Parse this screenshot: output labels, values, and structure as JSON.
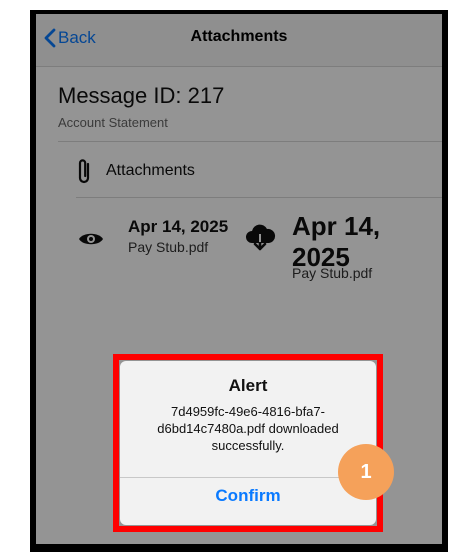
{
  "nav": {
    "back_label": "Back",
    "title": "Attachments"
  },
  "message": {
    "id_label": "Message ID: 217",
    "subtitle": "Account Statement"
  },
  "attachments_header": {
    "icon": "paperclip-icon",
    "label": "Attachments"
  },
  "items": [
    {
      "date": "Apr 14, 2025",
      "file": "Pay Stub.pdf",
      "icon": "eye-icon"
    },
    {
      "date": "Apr 14, 2025",
      "file": "Pay Stub.pdf",
      "icon": "cloud-download-icon"
    }
  ],
  "alert": {
    "title": "Alert",
    "message": "7d4959fc-49e6-4816-bfa7-d6bd14c7480a.pdf downloaded successfully.",
    "confirm_label": "Confirm"
  },
  "annotation": {
    "badge_number": "1",
    "badge_color": "#f5a15a",
    "highlight_color": "#ff0000"
  },
  "colors": {
    "accent": "#0a7aff"
  }
}
